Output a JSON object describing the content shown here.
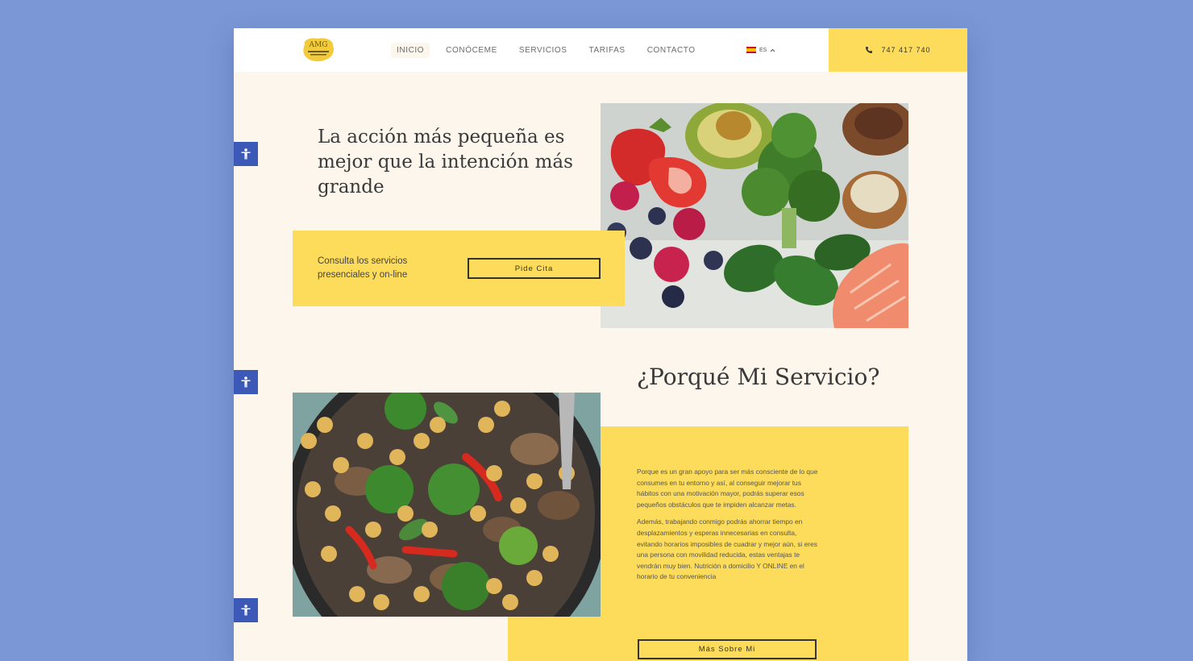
{
  "header": {
    "logo_text": "AMG",
    "nav": [
      "INICIO",
      "CONÓCEME",
      "SERVICIOS",
      "TARIFAS",
      "CONTACTO"
    ],
    "language": "ES",
    "phone": "747 417 740"
  },
  "hero": {
    "title": "La acción más pequeña es mejor que la intención más grande",
    "box_text": "Consulta los servicios presenciales y on-line",
    "cta": "Pide Cita"
  },
  "section2": {
    "title": "¿Porqué Mi Servicio?",
    "paragraph1": "Porque es un gran apoyo para ser más consciente de lo que consumes en tu entorno y así, al conseguir mejorar tus hábitos con una motivación mayor, podrás superar esos pequeños obstáculos que te impiden alcanzar metas.",
    "paragraph2": "Además, trabajando conmigo podrás ahorrar tiempo en desplazamientos y esperas innecesarias en consulta, evitando horarios imposibles de cuadrar y mejor aún, si eres una persona con movilidad reducida, estas ventajas te vendrán muy bien. Nutrición a domicilio Y ONLINE en el horario de tu conveniencia",
    "cta": "Más Sobre Mi"
  },
  "colors": {
    "accent": "#fddc5c",
    "page_bg": "#fdf6ec",
    "outer_bg": "#7b97d6",
    "a11y": "#3d59b8"
  }
}
